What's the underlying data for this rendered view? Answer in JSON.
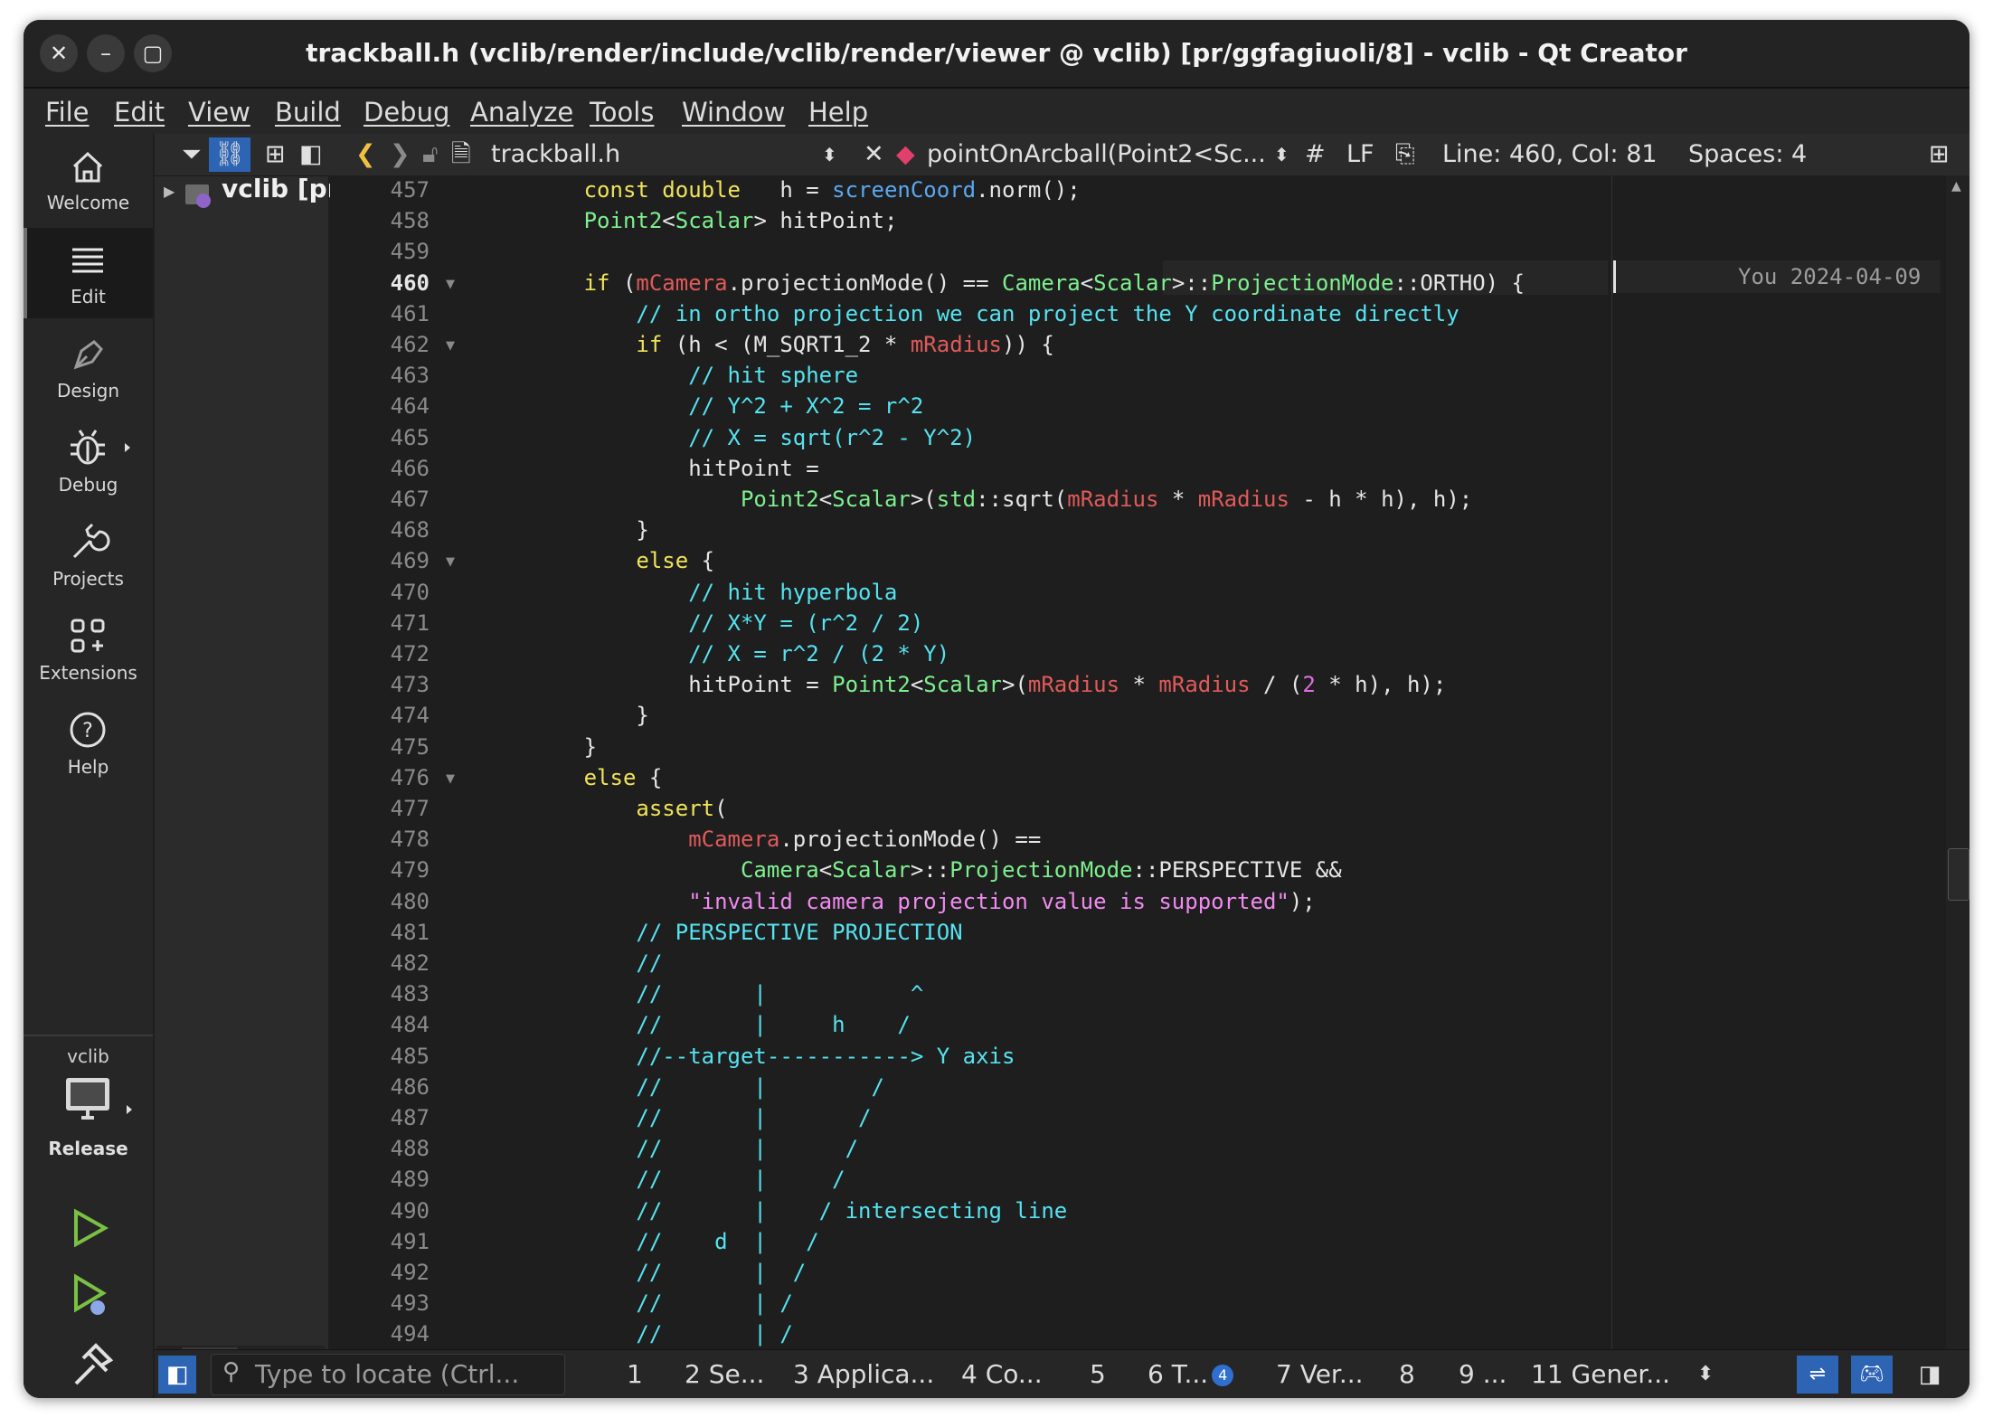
{
  "window": {
    "title": "trackball.h (vclib/render/include/vclib/render/viewer @ vclib) [pr/ggfagiuoli/8] - vclib - Qt Creator"
  },
  "menu": [
    "File",
    "Edit",
    "View",
    "Build",
    "Debug",
    "Analyze",
    "Tools",
    "Window",
    "Help"
  ],
  "modes": [
    {
      "label": "Welcome",
      "icon": "home-icon"
    },
    {
      "label": "Edit",
      "icon": "edit-icon"
    },
    {
      "label": "Design",
      "icon": "design-icon"
    },
    {
      "label": "Debug",
      "icon": "bug-icon"
    },
    {
      "label": "Projects",
      "icon": "wrench-icon"
    },
    {
      "label": "Extensions",
      "icon": "extensions-icon"
    },
    {
      "label": "Help",
      "icon": "help-icon"
    }
  ],
  "kit": {
    "project": "vclib",
    "config": "Release"
  },
  "project_tree": {
    "root": "vclib [pr"
  },
  "editor_toolbar": {
    "file": "trackball.h",
    "symbol": "pointOnArcball(Point2<Sc...",
    "hash": "#",
    "line_ending": "LF",
    "position": "Line: 460, Col: 81",
    "indent": "Spaces: 4"
  },
  "blame": "You 2024-04-09",
  "code": {
    "start": 457,
    "current": 460,
    "folds": [
      460,
      462,
      469,
      476
    ],
    "lines": [
      "        const double   h = screenCoord.norm();",
      "        Point2<Scalar> hitPoint;",
      "",
      "        if (mCamera.projectionMode() == Camera<Scalar>::ProjectionMode::ORTHO) {",
      "            // in ortho projection we can project the Y coordinate directly",
      "            if (h < (M_SQRT1_2 * mRadius)) {",
      "                // hit sphere",
      "                // Y^2 + X^2 = r^2",
      "                // X = sqrt(r^2 - Y^2)",
      "                hitPoint =",
      "                    Point2<Scalar>(std::sqrt(mRadius * mRadius - h * h), h);",
      "            }",
      "            else {",
      "                // hit hyperbola",
      "                // X*Y = (r^2 / 2)",
      "                // X = r^2 / (2 * Y)",
      "                hitPoint = Point2<Scalar>(mRadius * mRadius / (2 * h), h);",
      "            }",
      "        }",
      "        else {",
      "            assert(",
      "                mCamera.projectionMode() ==",
      "                    Camera<Scalar>::ProjectionMode::PERSPECTIVE &&",
      "                \"invalid camera projection value is supported\");",
      "            // PERSPECTIVE PROJECTION",
      "            //",
      "            //       |           ^",
      "            //       |     h    /",
      "            //--target-----------> Y axis",
      "            //       |        /",
      "            //       |       /",
      "            //       |      /",
      "            //       |     /",
      "            //       |    / intersecting line",
      "            //    d  |   /",
      "            //       |  /",
      "            //       | /",
      "            //       | /"
    ]
  },
  "status": {
    "locator_placeholder": "Type to locate (Ctrl...",
    "panes": [
      "1",
      "2 Se...",
      "3 Applica...",
      "4 Co...",
      "5",
      "6 T...",
      "7 Ver...",
      "8",
      "9 ...",
      "11 Gener..."
    ],
    "badge": "4"
  }
}
